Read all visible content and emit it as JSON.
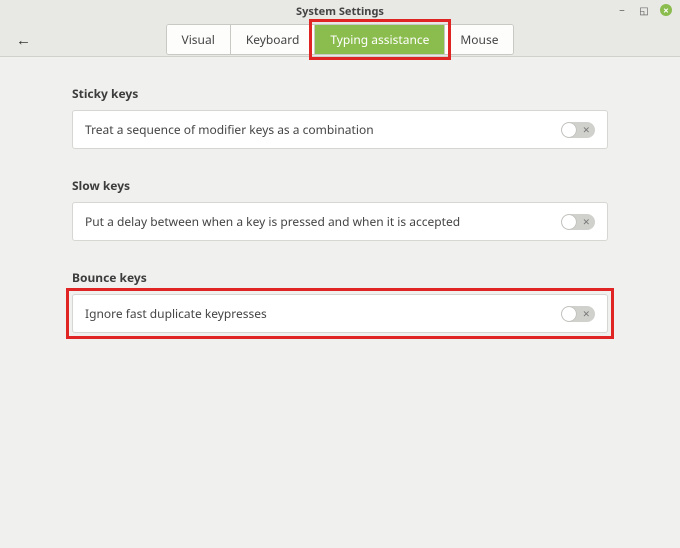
{
  "window": {
    "title": "System Settings",
    "minimize_icon": "−",
    "maximize_icon": "◱",
    "close_icon": "×"
  },
  "toolbar": {
    "back_icon": "←"
  },
  "tabs": {
    "visual": "Visual",
    "keyboard": "Keyboard",
    "typing_assistance": "Typing assistance",
    "mouse": "Mouse",
    "active": "typing_assistance"
  },
  "sections": {
    "sticky": {
      "heading": "Sticky keys",
      "row": "Treat a sequence of modifier keys as a combination",
      "enabled": false
    },
    "slow": {
      "heading": "Slow keys",
      "row": "Put a delay between when a key is pressed and when it is accepted",
      "enabled": false
    },
    "bounce": {
      "heading": "Bounce keys",
      "row": "Ignore fast duplicate keypresses",
      "enabled": false
    }
  },
  "highlights": {
    "tabs": true,
    "bounce_row": true
  }
}
